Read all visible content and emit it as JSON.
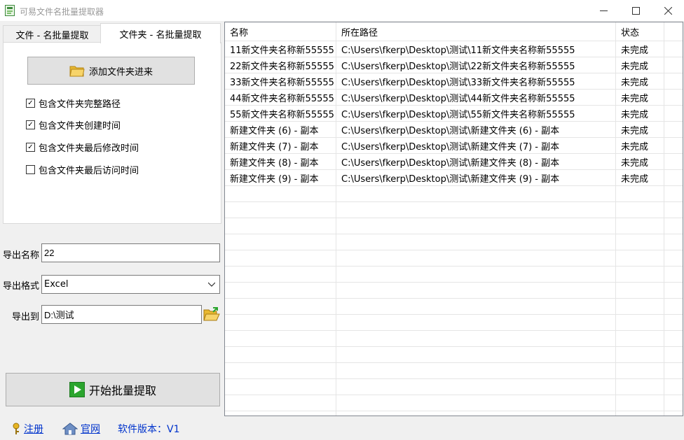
{
  "window": {
    "title": "可易文件名批量提取器",
    "minimize_icon": "minimize-icon",
    "maximize_icon": "maximize-icon",
    "close_icon": "close-icon"
  },
  "tabs": [
    {
      "label": "文件 - 名批量提取"
    },
    {
      "label": "文件夹 - 名批量提取"
    }
  ],
  "panel": {
    "add_button_label": "添加文件夹进来",
    "checkboxes": [
      {
        "label": "包含文件夹完整路径",
        "checked": true
      },
      {
        "label": "包含文件夹创建时间",
        "checked": true
      },
      {
        "label": "包含文件夹最后修改时间",
        "checked": true
      },
      {
        "label": "包含文件夹最后访问时间",
        "checked": false
      }
    ]
  },
  "export": {
    "name_label": "导出名称",
    "name_value": "22",
    "format_label": "导出格式",
    "format_value": "Excel",
    "to_label": "导出到",
    "to_value": "D:\\测试",
    "start_button_label": "开始批量提取"
  },
  "table": {
    "columns": [
      "名称",
      "所在路径",
      "状态"
    ],
    "rows": [
      [
        "11新文件夹名称新55555",
        "C:\\Users\\fkerp\\Desktop\\测试\\11新文件夹名称新55555",
        "未完成"
      ],
      [
        "22新文件夹名称新55555",
        "C:\\Users\\fkerp\\Desktop\\测试\\22新文件夹名称新55555",
        "未完成"
      ],
      [
        "33新文件夹名称新55555",
        "C:\\Users\\fkerp\\Desktop\\测试\\33新文件夹名称新55555",
        "未完成"
      ],
      [
        "44新文件夹名称新55555",
        "C:\\Users\\fkerp\\Desktop\\测试\\44新文件夹名称新55555",
        "未完成"
      ],
      [
        "55新文件夹名称新55555",
        "C:\\Users\\fkerp\\Desktop\\测试\\55新文件夹名称新55555",
        "未完成"
      ],
      [
        "新建文件夹 (6) - 副本",
        "C:\\Users\\fkerp\\Desktop\\测试\\新建文件夹 (6) - 副本",
        "未完成"
      ],
      [
        "新建文件夹 (7) - 副本",
        "C:\\Users\\fkerp\\Desktop\\测试\\新建文件夹 (7) - 副本",
        "未完成"
      ],
      [
        "新建文件夹 (8) - 副本",
        "C:\\Users\\fkerp\\Desktop\\测试\\新建文件夹 (8) - 副本",
        "未完成"
      ],
      [
        "新建文件夹 (9) - 副本",
        "C:\\Users\\fkerp\\Desktop\\测试\\新建文件夹 (9) - 副本",
        "未完成"
      ]
    ]
  },
  "footer": {
    "register_label": "注册",
    "website_label": "官网",
    "version_text": "软件版本：V1"
  },
  "colors": {
    "link": "#0033cc",
    "play_icon": "#2ba52e",
    "folder_icon": "#f0c048"
  }
}
